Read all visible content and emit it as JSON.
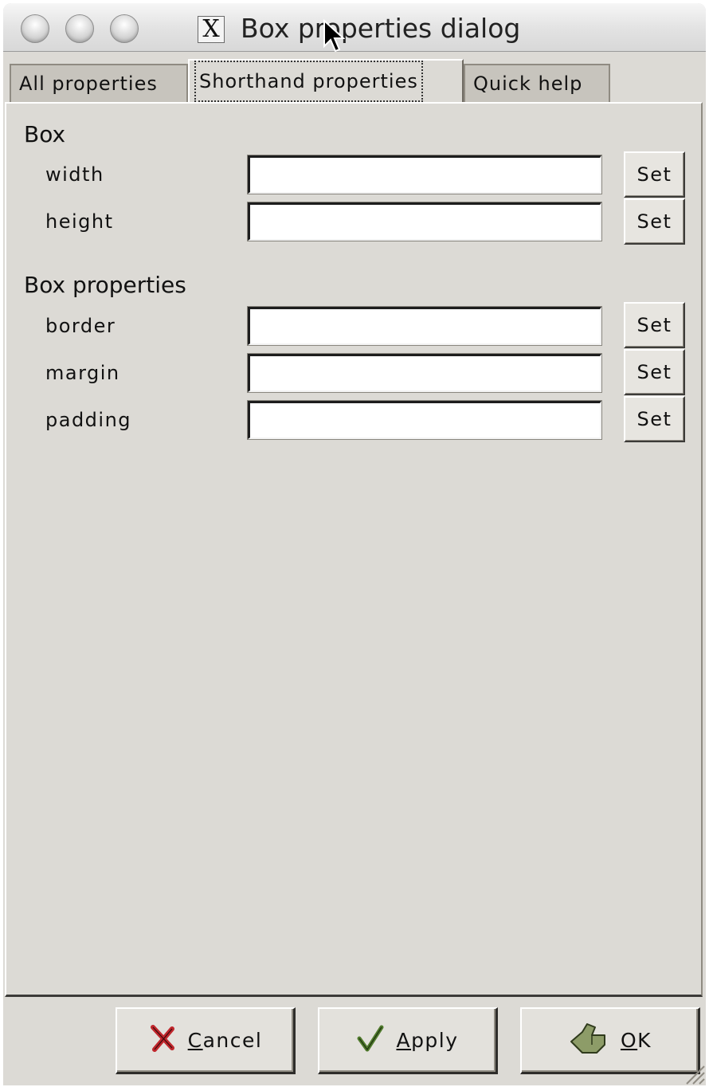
{
  "window": {
    "title": "Box properties dialog",
    "app_icon_glyph": "X"
  },
  "tabs": [
    {
      "label": "All properties",
      "active": false
    },
    {
      "label": "Shorthand properties",
      "active": true
    },
    {
      "label": "Quick help",
      "active": false
    }
  ],
  "sections": [
    {
      "heading": "Box",
      "rows": [
        {
          "label": "width",
          "value": "",
          "button": "Set"
        },
        {
          "label": "height",
          "value": "",
          "button": "Set"
        }
      ]
    },
    {
      "heading": "Box properties",
      "rows": [
        {
          "label": "border",
          "value": "",
          "button": "Set"
        },
        {
          "label": "margin",
          "value": "",
          "button": "Set"
        },
        {
          "label": "padding",
          "value": "",
          "button": "Set"
        }
      ]
    }
  ],
  "buttons": {
    "cancel": {
      "mnemonic": "C",
      "rest": "ancel",
      "icon": "cancel-x-icon",
      "icon_color": "#c0262c"
    },
    "apply": {
      "mnemonic": "A",
      "rest": "pply",
      "icon": "checkmark-icon",
      "icon_color": "#4f7a2c"
    },
    "ok": {
      "mnemonic": "O",
      "rest": "K",
      "icon": "ok-hand-icon",
      "icon_color": "#7d8c5a"
    }
  },
  "colors": {
    "dialog_bg": "#dcdad5",
    "field_bg": "#ffffff"
  }
}
